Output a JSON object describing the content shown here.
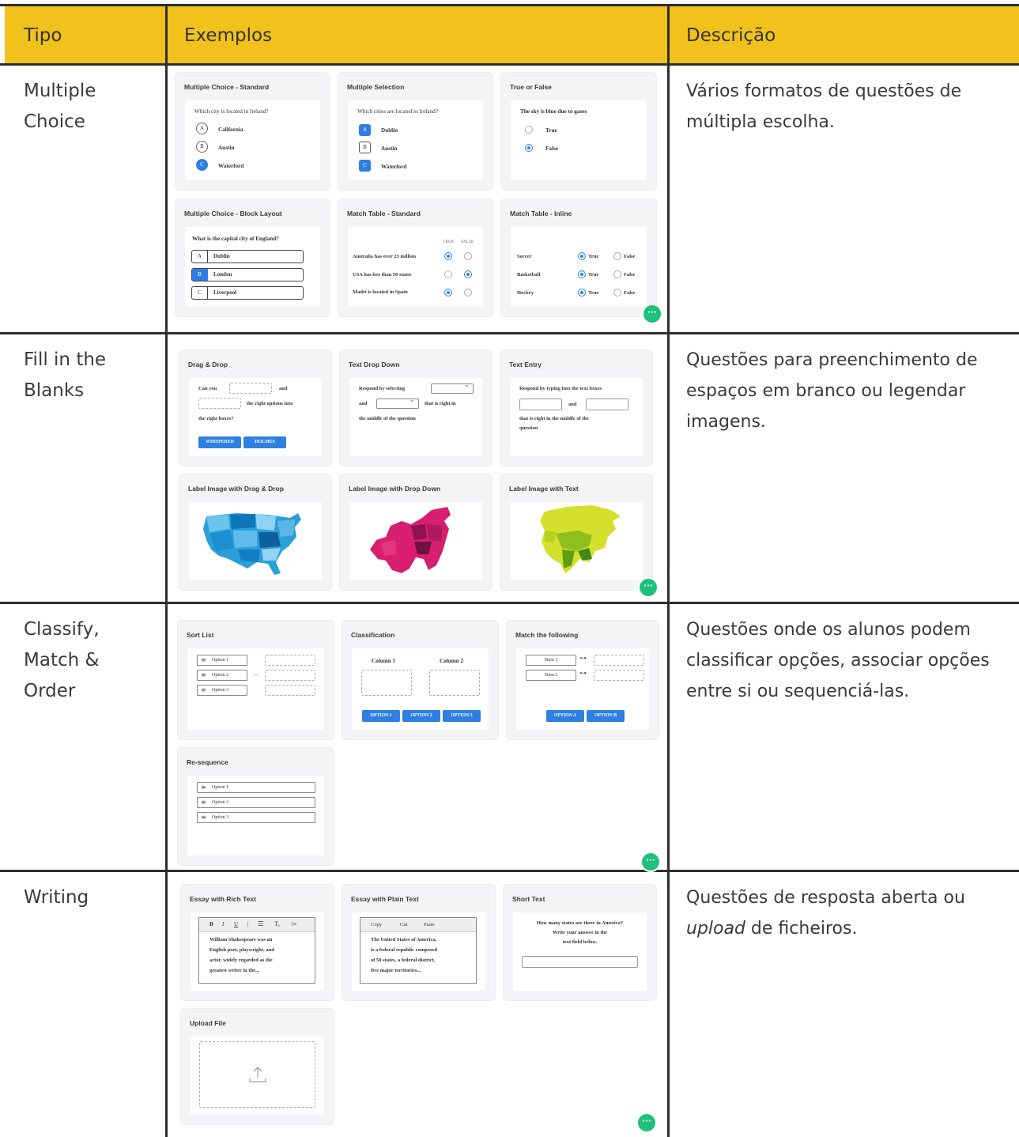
{
  "header": {
    "col1": "Tipo",
    "col2": "Exemplos",
    "col3": "Descrição"
  },
  "rows": [
    {
      "type_line1": "Multiple",
      "type_line2": "Choice",
      "description": "Vários formatos de questões de múltipla escolha."
    },
    {
      "type_line1": "Fill in the",
      "type_line2": "Blanks",
      "description": "Questões para preenchimento de espaços em branco ou legendar imagens."
    },
    {
      "type_line1": "Classify,",
      "type_line2": "Match &",
      "type_line3": "Order",
      "description": "Questões onde os alunos podem classificar opções, associar opções entre si ou sequenciá-las."
    },
    {
      "type_line1": "Writing",
      "description_a": "Questões de resposta aberta ou ",
      "description_em": "upload",
      "description_b": " de ficheiros."
    }
  ],
  "mc": {
    "standard": {
      "title": "Multiple Choice - Standard",
      "question": "Which city is located in Ireland?",
      "options": [
        {
          "key": "A",
          "label": "California"
        },
        {
          "key": "B",
          "label": "Austin"
        },
        {
          "key": "C",
          "label": "Waterford"
        }
      ]
    },
    "selection": {
      "title": "Multiple Selection",
      "question": "Which cities are located in Ireland?",
      "options": [
        {
          "key": "A",
          "label": "Dublin"
        },
        {
          "key": "B",
          "label": "Austin"
        },
        {
          "key": "C",
          "label": "Waterford"
        }
      ]
    },
    "truefalse": {
      "title": "True or False",
      "question": "The sky is blue due to gases",
      "options": [
        "True",
        "False"
      ]
    },
    "block": {
      "title": "Multiple Choice - Block Layout",
      "question": "What is the capital city of England?",
      "options": [
        {
          "key": "A",
          "label": "Dublin"
        },
        {
          "key": "B",
          "label": "London"
        },
        {
          "key": "C",
          "label": "Liverpool"
        }
      ]
    },
    "match_standard": {
      "title": "Match Table - Standard",
      "col_true": "TRUE",
      "col_false": "FALSE",
      "rows": [
        "Australia has over 23 million",
        "USA has less than 50 states",
        "Madri is located in Spain"
      ]
    },
    "match_inline": {
      "title": "Match Table - Inline",
      "rows": [
        "Soccer",
        "Basketball",
        "Hockey"
      ],
      "true_label": "True",
      "false_label": "False"
    }
  },
  "fill": {
    "dragdrop": {
      "title": "Drag & Drop",
      "t1": "Can you",
      "t2": "and",
      "t3": "the right options into",
      "t4": "the right boxes?",
      "btn1": "WHISPERED",
      "btn2": "HOLMES"
    },
    "dropdown": {
      "title": "Text Drop Down",
      "t1": "Respond by selecting",
      "t2": "and",
      "t3": "that is right in",
      "t4": "the middle of the question"
    },
    "entry": {
      "title": "Text Entry",
      "t1": "Respond by typing into the text boxes",
      "t2": "and",
      "t3": "that is right in the middle of the",
      "t4": "question"
    },
    "label_dd": {
      "title": "Label Image with Drag & Drop"
    },
    "label_drop": {
      "title": "Label Image with Drop Down"
    },
    "label_text": {
      "title": "Label Image with Text"
    }
  },
  "classify": {
    "sort": {
      "title": "Sort List",
      "options": [
        "Option 1",
        "Option 2",
        "Option 3"
      ]
    },
    "classification": {
      "title": "Classification",
      "col1": "Column 1",
      "col2": "Column 2",
      "buttons": [
        "OPTION 1",
        "OPTION 2",
        "OPTION 3"
      ]
    },
    "match": {
      "title": "Match the following",
      "stems": [
        "Stem 1",
        "Stem 2"
      ],
      "buttons": [
        "OPTION A",
        "OPTION B"
      ]
    },
    "reseq": {
      "title": "Re-sequence",
      "options": [
        "Option 1",
        "Option 2",
        "Option 3"
      ]
    }
  },
  "writing": {
    "rich": {
      "title": "Essay with Rich Text",
      "text1": "William Shakespeare was an",
      "text2": "English poet, playwright, and",
      "text3": "actor, widely regarded as the",
      "text4": "greatest writer in the..."
    },
    "plain": {
      "title": "Essay with Plain Text",
      "copy": "Copy",
      "cut": "Cut",
      "paste": "Paste",
      "text1": "The United States of America,",
      "text2": "is a federal republic composed",
      "text3": "of 50 states, a federal district,",
      "text4": "five major territories..."
    },
    "short": {
      "title": "Short Text",
      "q1": "How many states are there in America?",
      "q2": "Write your answer in the",
      "q3": "text field below."
    },
    "upload": {
      "title": "Upload File"
    }
  },
  "icons": {
    "chat": "chat-bubble-icon",
    "upload": "upload-icon",
    "drag_handle": "drag-handle-icon"
  },
  "colors": {
    "header": "#f1c21b",
    "accent": "#2f7fe3",
    "chat": "#1ec07a"
  }
}
